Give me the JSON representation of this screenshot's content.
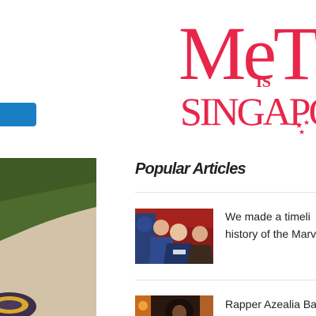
{
  "promo": {
    "line1": "MeTH",
    "line2": "IS",
    "line3": "SINGAPO",
    "color": "#e8264a"
  },
  "popular": {
    "title": "Popular Articles",
    "articles": [
      {
        "lines": [
          "We made a timeli",
          "history of the Marv"
        ]
      },
      {
        "lines": [
          "Rapper Azealia Ba"
        ]
      }
    ]
  },
  "colors": {
    "accent_blue": "#1a7ec4",
    "text": "#222222"
  }
}
